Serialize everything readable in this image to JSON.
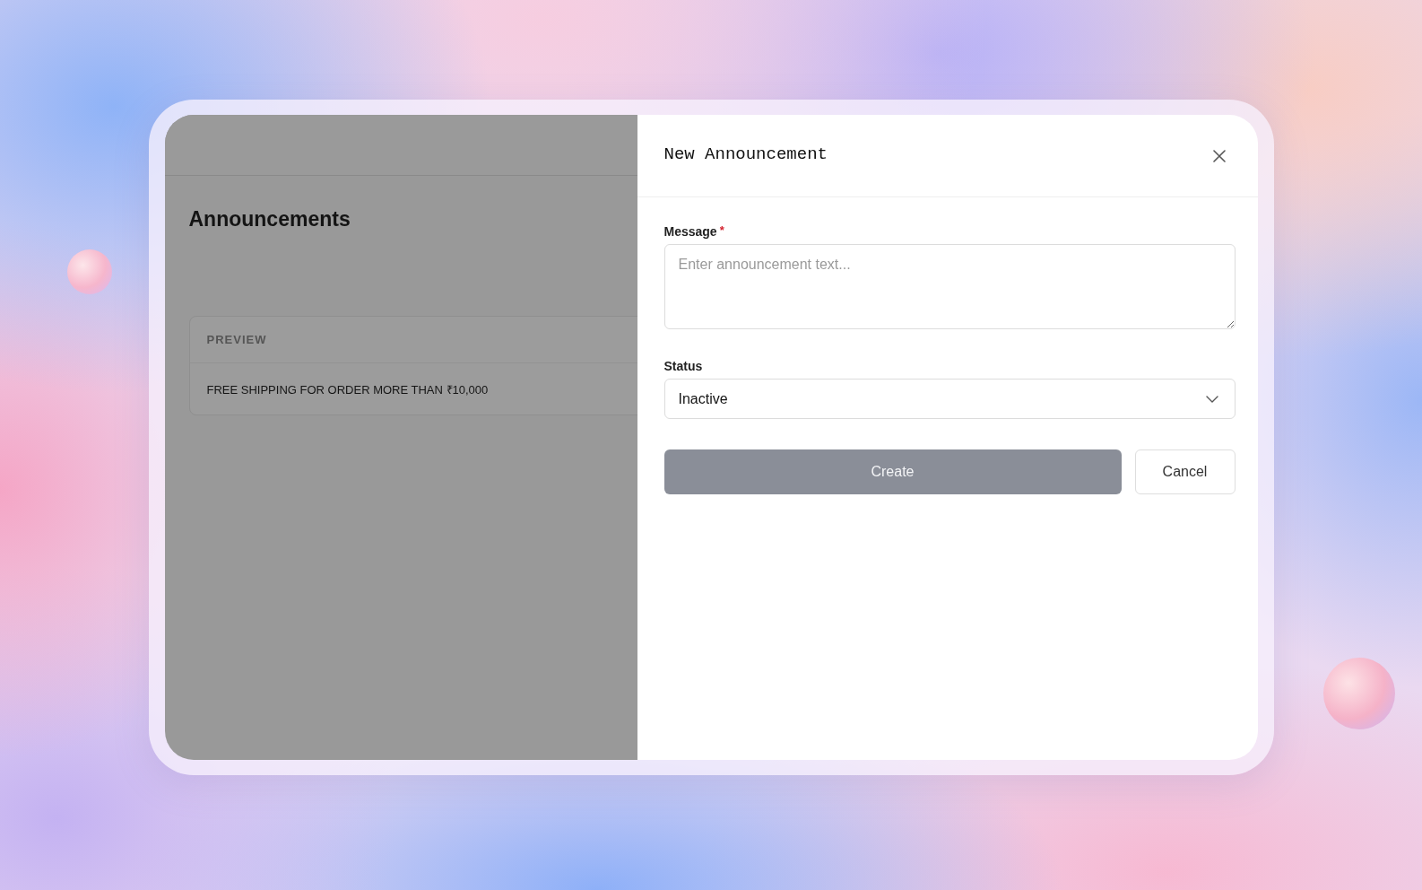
{
  "page": {
    "title": "Announcements",
    "preview": {
      "label": "PREVIEW",
      "text": "FREE SHIPPING FOR ORDER MORE THAN ₹10,000"
    }
  },
  "drawer": {
    "title": "New Announcement",
    "fields": [
      {
        "kind": "textarea",
        "label": "Message",
        "required_mark": "*",
        "placeholder": "Enter announcement text..."
      },
      {
        "kind": "select",
        "label": "Status",
        "value": "Inactive"
      }
    ],
    "buttons": [
      {
        "kind": "primary",
        "label": "Create",
        "disabled": true
      },
      {
        "kind": "secondary",
        "label": "Cancel"
      }
    ]
  }
}
